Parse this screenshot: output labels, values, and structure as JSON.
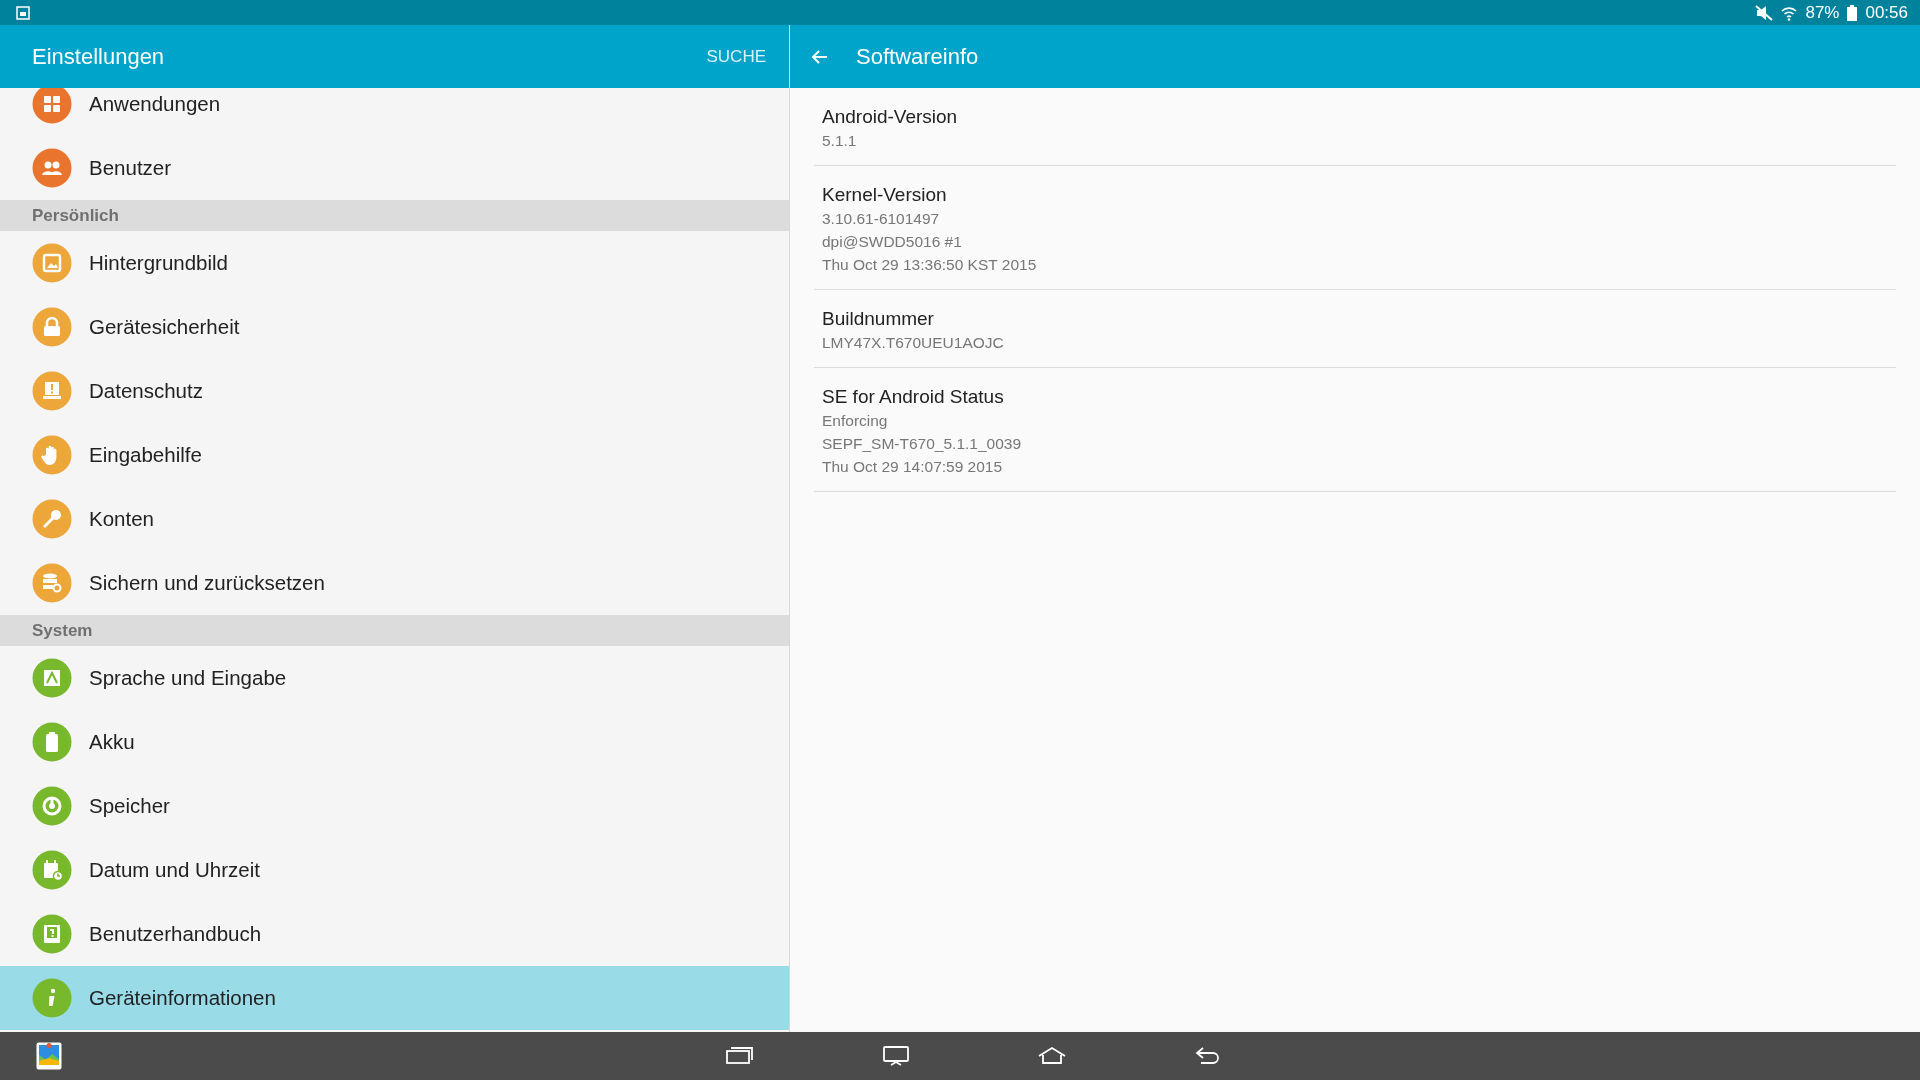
{
  "status_bar": {
    "battery": "87%",
    "time": "00:56"
  },
  "settings_panel": {
    "title": "Einstellungen",
    "search_button": "SUCHE",
    "items": [
      {
        "kind": "item",
        "label": "Anwendungen",
        "color": "#e8742d",
        "selected": false
      },
      {
        "kind": "item",
        "label": "Benutzer",
        "color": "#e8742d",
        "selected": false
      },
      {
        "kind": "section",
        "label": "Persönlich"
      },
      {
        "kind": "item",
        "label": "Hintergrundbild",
        "color": "#eca63a",
        "selected": false
      },
      {
        "kind": "item",
        "label": "Gerätesicherheit",
        "color": "#eca63a",
        "selected": false
      },
      {
        "kind": "item",
        "label": "Datenschutz",
        "color": "#eca63a",
        "selected": false
      },
      {
        "kind": "item",
        "label": "Eingabehilfe",
        "color": "#eca63a",
        "selected": false
      },
      {
        "kind": "item",
        "label": "Konten",
        "color": "#eca63a",
        "selected": false
      },
      {
        "kind": "item",
        "label": "Sichern und zurücksetzen",
        "color": "#eca63a",
        "selected": false
      },
      {
        "kind": "section",
        "label": "System"
      },
      {
        "kind": "item",
        "label": "Sprache und Eingabe",
        "color": "#77b82c",
        "selected": false
      },
      {
        "kind": "item",
        "label": "Akku",
        "color": "#77b82c",
        "selected": false
      },
      {
        "kind": "item",
        "label": "Speicher",
        "color": "#77b82c",
        "selected": false
      },
      {
        "kind": "item",
        "label": "Datum und Uhrzeit",
        "color": "#77b82c",
        "selected": false
      },
      {
        "kind": "item",
        "label": "Benutzerhandbuch",
        "color": "#77b82c",
        "selected": false
      },
      {
        "kind": "item",
        "label": "Geräteinformationen",
        "color": "#77b82c",
        "selected": true
      }
    ]
  },
  "detail_panel": {
    "title": "Softwareinfo",
    "entries": [
      {
        "title": "Android-Version",
        "lines": [
          "5.1.1"
        ]
      },
      {
        "title": "Kernel-Version",
        "lines": [
          "3.10.61-6101497",
          "dpi@SWDD5016 #1",
          "Thu Oct 29 13:36:50 KST 2015"
        ]
      },
      {
        "title": "Buildnummer",
        "lines": [
          "LMY47X.T670UEU1AOJC"
        ]
      },
      {
        "title": "SE for Android Status",
        "lines": [
          "Enforcing",
          "SEPF_SM-T670_5.1.1_0039",
          "Thu Oct 29 14:07:59 2015"
        ]
      }
    ]
  }
}
